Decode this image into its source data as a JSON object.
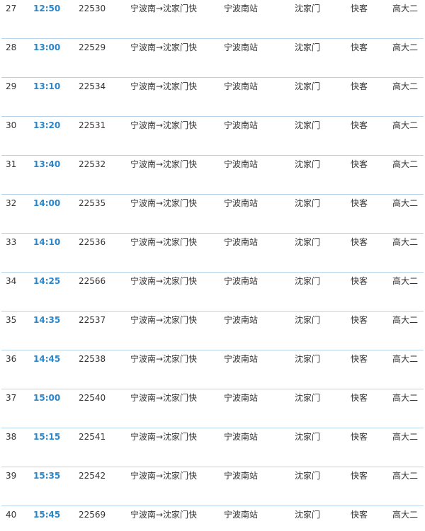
{
  "rows": [
    {
      "no": "27",
      "time": "12:50",
      "train": "22530",
      "route": "宁波南→沈家门快",
      "from": "宁波南站",
      "to": "沈家门",
      "type": "快客",
      "car": "高大二"
    },
    {
      "no": "28",
      "time": "13:00",
      "train": "22529",
      "route": "宁波南→沈家门快",
      "from": "宁波南站",
      "to": "沈家门",
      "type": "快客",
      "car": "高大二"
    },
    {
      "no": "29",
      "time": "13:10",
      "train": "22534",
      "route": "宁波南→沈家门快",
      "from": "宁波南站",
      "to": "沈家门",
      "type": "快客",
      "car": "高大二"
    },
    {
      "no": "30",
      "time": "13:20",
      "train": "22531",
      "route": "宁波南→沈家门快",
      "from": "宁波南站",
      "to": "沈家门",
      "type": "快客",
      "car": "高大二"
    },
    {
      "no": "31",
      "time": "13:40",
      "train": "22532",
      "route": "宁波南→沈家门快",
      "from": "宁波南站",
      "to": "沈家门",
      "type": "快客",
      "car": "高大二"
    },
    {
      "no": "32",
      "time": "14:00",
      "train": "22535",
      "route": "宁波南→沈家门快",
      "from": "宁波南站",
      "to": "沈家门",
      "type": "快客",
      "car": "高大二"
    },
    {
      "no": "33",
      "time": "14:10",
      "train": "22536",
      "route": "宁波南→沈家门快",
      "from": "宁波南站",
      "to": "沈家门",
      "type": "快客",
      "car": "高大二"
    },
    {
      "no": "34",
      "time": "14:25",
      "train": "22566",
      "route": "宁波南→沈家门快",
      "from": "宁波南站",
      "to": "沈家门",
      "type": "快客",
      "car": "高大二"
    },
    {
      "no": "35",
      "time": "14:35",
      "train": "22537",
      "route": "宁波南→沈家门快",
      "from": "宁波南站",
      "to": "沈家门",
      "type": "快客",
      "car": "高大二"
    },
    {
      "no": "36",
      "time": "14:45",
      "train": "22538",
      "route": "宁波南→沈家门快",
      "from": "宁波南站",
      "to": "沈家门",
      "type": "快客",
      "car": "高大二"
    },
    {
      "no": "37",
      "time": "15:00",
      "train": "22540",
      "route": "宁波南→沈家门快",
      "from": "宁波南站",
      "to": "沈家门",
      "type": "快客",
      "car": "高大二"
    },
    {
      "no": "38",
      "time": "15:15",
      "train": "22541",
      "route": "宁波南→沈家门快",
      "from": "宁波南站",
      "to": "沈家门",
      "type": "快客",
      "car": "高大二"
    },
    {
      "no": "39",
      "time": "15:35",
      "train": "22542",
      "route": "宁波南→沈家门快",
      "from": "宁波南站",
      "to": "沈家门",
      "type": "快客",
      "car": "高大二"
    },
    {
      "no": "40",
      "time": "15:45",
      "train": "22569",
      "route": "宁波南→沈家门快",
      "from": "宁波南站",
      "to": "沈家门",
      "type": "快客",
      "car": "高大二"
    }
  ]
}
